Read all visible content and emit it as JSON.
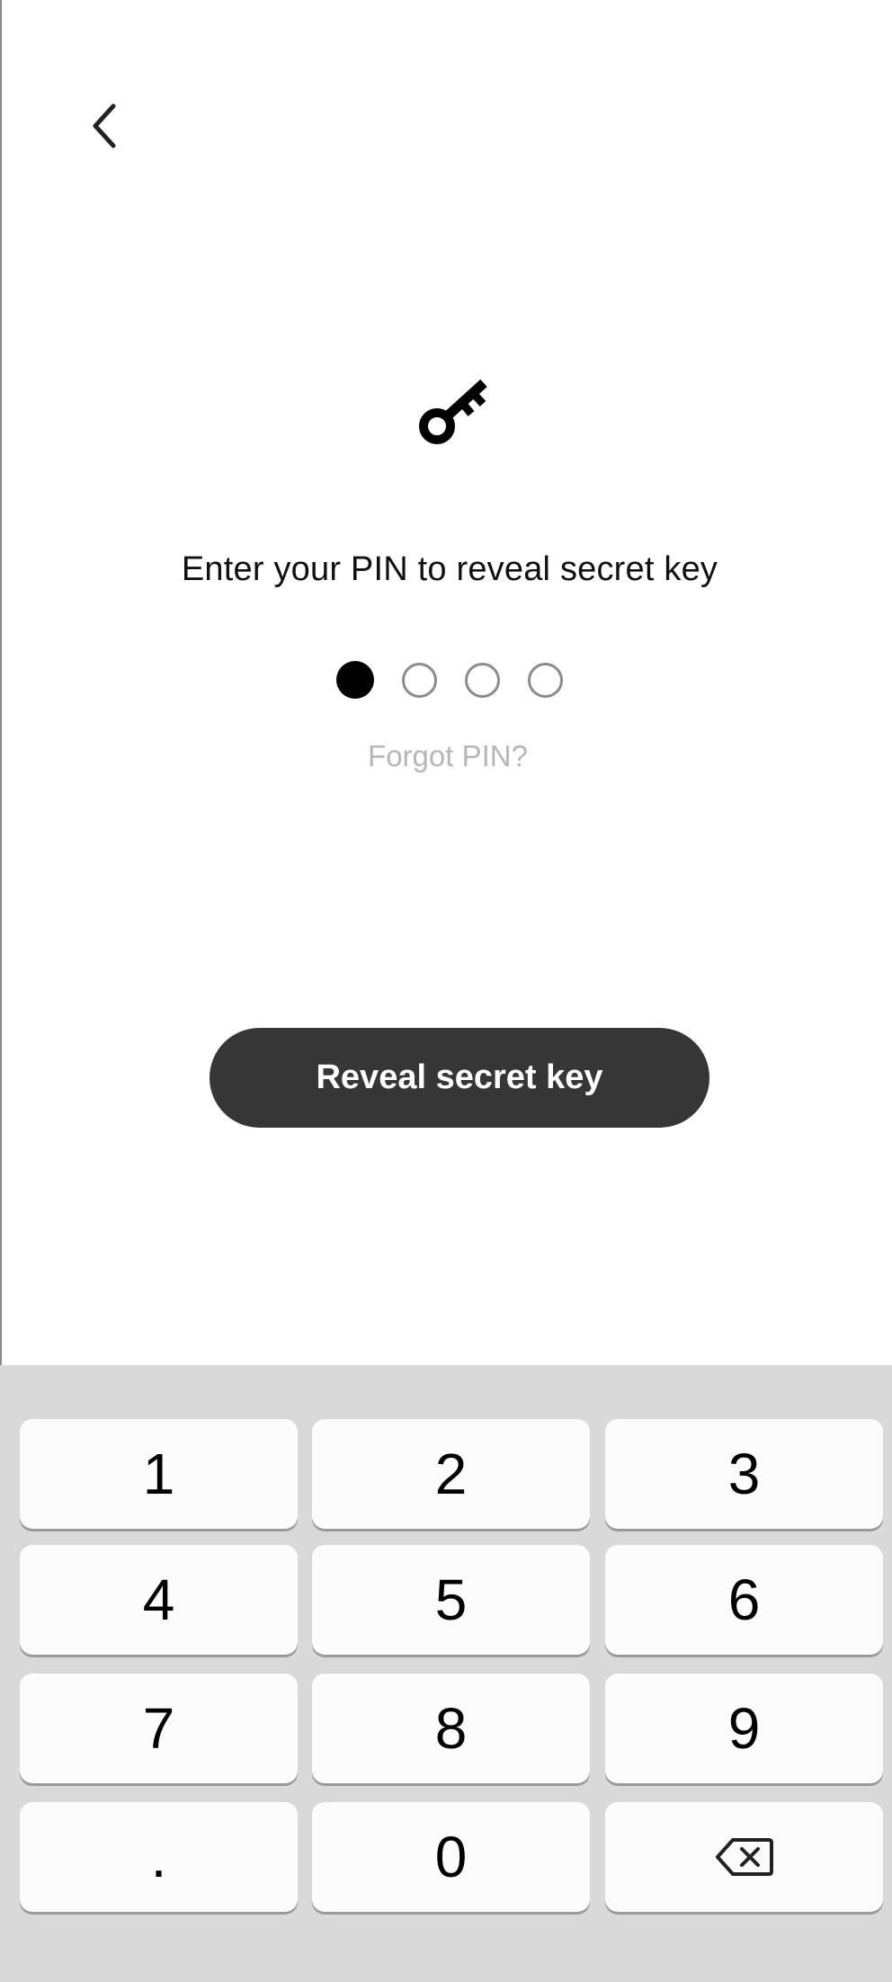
{
  "header": {
    "back_icon": "chevron-left-icon"
  },
  "main": {
    "key_icon": "key-icon",
    "prompt": "Enter your PIN to reveal secret key",
    "pin": {
      "length": 4,
      "filled": 1
    },
    "forgot_label": "Forgot PIN?",
    "reveal_label": "Reveal secret key"
  },
  "keypad": {
    "keys": [
      "1",
      "2",
      "3",
      "4",
      "5",
      "6",
      "7",
      "8",
      "9",
      ".",
      "0"
    ],
    "backspace_icon": "backspace-icon"
  },
  "colors": {
    "button_bg": "#363636",
    "keypad_bg": "#d9d9d9",
    "key_bg": "#fcfcfd",
    "muted_text": "#b7b7b7"
  }
}
